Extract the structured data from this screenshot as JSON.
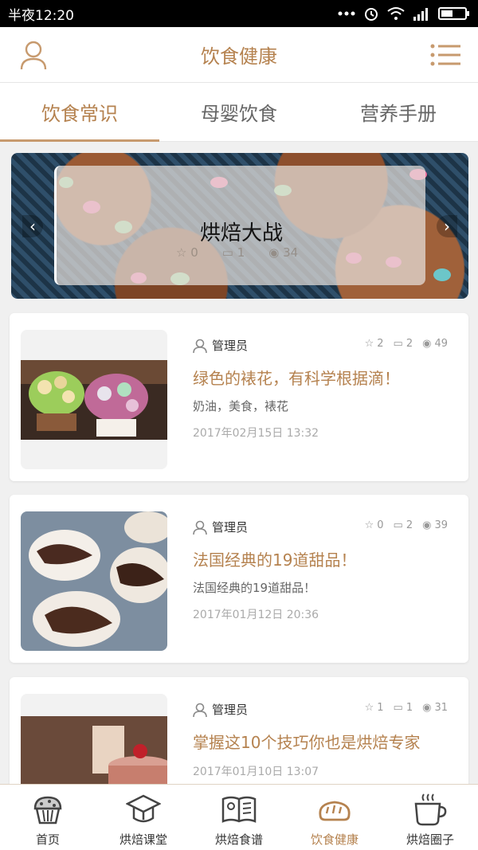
{
  "status_bar": {
    "time": "半夜12:20"
  },
  "header": {
    "title": "饮食健康"
  },
  "tabs": [
    {
      "label": "饮食常识",
      "active": true
    },
    {
      "label": "母婴饮食",
      "active": false
    },
    {
      "label": "营养手册",
      "active": false
    }
  ],
  "banner": {
    "title": "烘焙大战",
    "meta": {
      "likes": "0",
      "comments": "1",
      "views": "34"
    }
  },
  "articles": [
    {
      "author": "管理员",
      "likes": "2",
      "comments": "2",
      "views": "49",
      "title": "绿色的裱花，有科学根据滴！",
      "tags": "奶油，美食，裱花",
      "date": "2017年02月15日 13:32"
    },
    {
      "author": "管理员",
      "likes": "0",
      "comments": "2",
      "views": "39",
      "title": "法国经典的19道甜品！",
      "tags": "法国经典的19道甜品！",
      "date": "2017年01月12日 20:36"
    },
    {
      "author": "管理员",
      "likes": "1",
      "comments": "1",
      "views": "31",
      "title": "掌握这10个技巧你也是烘焙专家",
      "tags": "",
      "date": "2017年01月10日 13:07"
    }
  ],
  "bottom_nav": [
    {
      "label": "首页",
      "icon": "cupcake-icon",
      "active": false
    },
    {
      "label": "烘焙课堂",
      "icon": "graduation-cap-icon",
      "active": false
    },
    {
      "label": "烘焙食谱",
      "icon": "recipe-book-icon",
      "active": false
    },
    {
      "label": "饮食健康",
      "icon": "bread-icon",
      "active": true
    },
    {
      "label": "烘焙圈子",
      "icon": "coffee-cup-icon",
      "active": false
    }
  ],
  "colors": {
    "accent": "#b5824f",
    "text": "#333333",
    "muted": "#999999"
  }
}
